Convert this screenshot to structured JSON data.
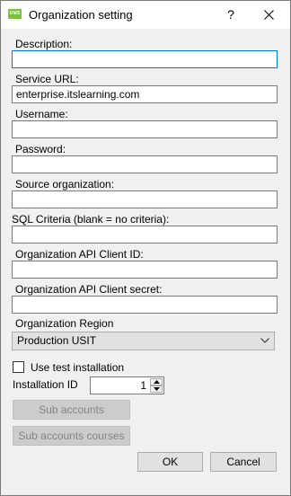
{
  "window": {
    "title": "Organization setting",
    "app_icon_text": "UMS",
    "help_label": "?"
  },
  "fields": [
    {
      "label": "Description:",
      "value": ""
    },
    {
      "label": "Service URL:",
      "value": "enterprise.itslearning.com"
    },
    {
      "label": "Username:",
      "value": ""
    },
    {
      "label": "Password:",
      "value": ""
    },
    {
      "label": "Source organization:",
      "value": ""
    },
    {
      "label": "SQL Criteria (blank = no criteria):",
      "value": ""
    },
    {
      "label": "Organization API Client ID:",
      "value": ""
    },
    {
      "label": "Organization API Client secret:",
      "value": ""
    }
  ],
  "region": {
    "label": "Organization Region",
    "selected": "Production USIT"
  },
  "test_installation": {
    "label": "Use test installation",
    "checked": false
  },
  "installation_id": {
    "label": "Installation ID",
    "value": "1"
  },
  "buttons": {
    "sub_accounts": "Sub accounts",
    "sub_accounts_courses": "Sub accounts courses",
    "ok": "OK",
    "cancel": "Cancel"
  },
  "colors": {
    "window_bg": "#f0f0f0",
    "focus_border": "#0078d7",
    "app_icon": "#7ac143"
  }
}
